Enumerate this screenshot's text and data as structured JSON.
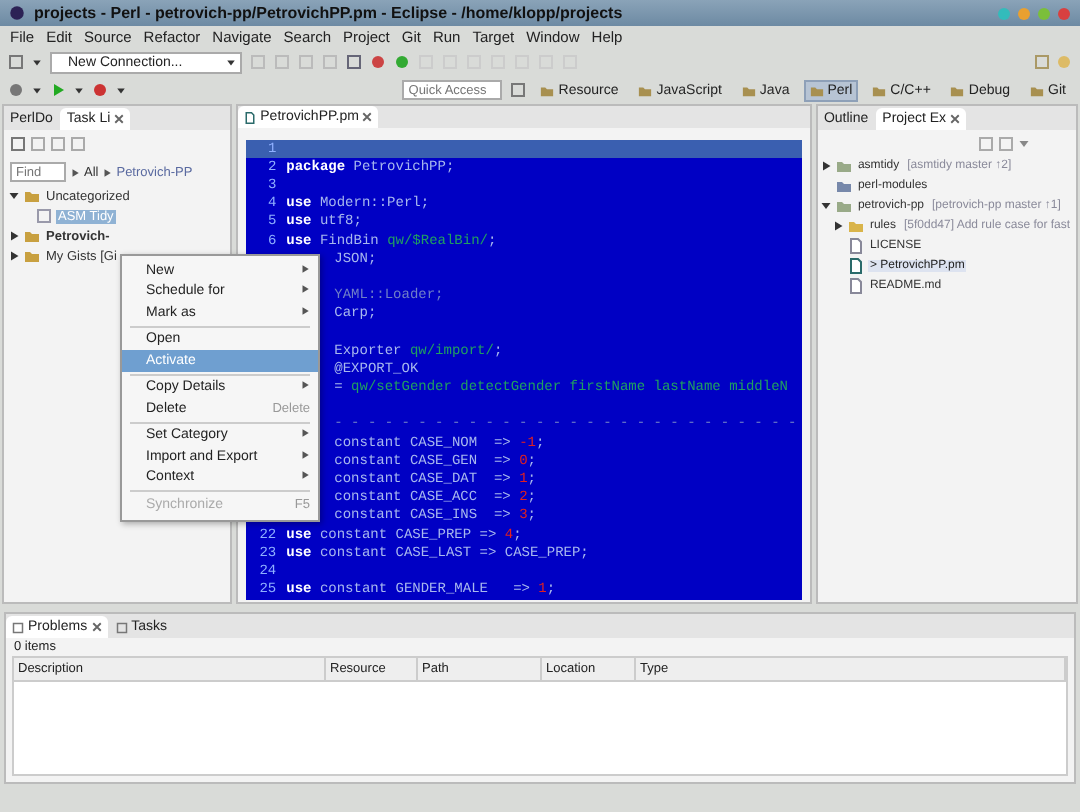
{
  "window": {
    "title": "projects - Perl - petrovich-pp/PetrovichPP.pm - Eclipse - /home/klopp/projects"
  },
  "menu": [
    "File",
    "Edit",
    "Source",
    "Refactor",
    "Navigate",
    "Search",
    "Project",
    "Git",
    "Run",
    "Target",
    "Window",
    "Help"
  ],
  "toolbar": {
    "connection": "New Connection...",
    "quick_access": {
      "placeholder": "Quick Access"
    },
    "perspectives": [
      {
        "label": "Resource",
        "selected": false
      },
      {
        "label": "JavaScript",
        "selected": false
      },
      {
        "label": "Java",
        "selected": false
      },
      {
        "label": "Perl",
        "selected": true
      },
      {
        "label": "C/C++",
        "selected": false
      },
      {
        "label": "Debug",
        "selected": false
      },
      {
        "label": "Git",
        "selected": false
      }
    ]
  },
  "left_panel": {
    "tabs": [
      {
        "label": "PerlDo",
        "selected": false
      },
      {
        "label": "Task Li",
        "selected": true
      }
    ],
    "find": {
      "placeholder": "Find"
    },
    "breadcrumb": [
      "All",
      "Petrovich-PP"
    ],
    "tree": [
      {
        "label": "Uncategorized",
        "expanded": true,
        "children": [
          {
            "label": "ASM Tidy",
            "selected": true
          }
        ]
      },
      {
        "label": "Petrovich-",
        "expanded": false
      },
      {
        "label": "My Gists [Gi",
        "expanded": false
      }
    ]
  },
  "context_menu": [
    {
      "label": "New",
      "kind": "submenu",
      "selected": false,
      "disabled": false
    },
    {
      "label": "Schedule for",
      "kind": "submenu",
      "selected": false,
      "disabled": false
    },
    {
      "label": "Mark as",
      "kind": "submenu",
      "selected": false,
      "disabled": false
    },
    {
      "kind": "separator"
    },
    {
      "label": "Open",
      "kind": "item",
      "selected": false,
      "disabled": false
    },
    {
      "label": "Activate",
      "kind": "item",
      "selected": true,
      "disabled": false
    },
    {
      "kind": "separator"
    },
    {
      "label": "Copy Details",
      "kind": "submenu",
      "selected": false,
      "disabled": false
    },
    {
      "label": "Delete",
      "kind": "item",
      "shortcut": "Delete",
      "selected": false,
      "disabled": false
    },
    {
      "kind": "separator"
    },
    {
      "label": "Set Category",
      "kind": "submenu",
      "selected": false,
      "disabled": false
    },
    {
      "label": "Import and Export",
      "kind": "submenu",
      "selected": false,
      "disabled": false
    },
    {
      "label": "Context",
      "kind": "submenu",
      "selected": false,
      "disabled": false
    },
    {
      "kind": "separator"
    },
    {
      "label": "Synchronize",
      "kind": "item",
      "shortcut": "F5",
      "selected": false,
      "disabled": true
    }
  ],
  "editor": {
    "tab": "PetrovichPP.pm",
    "lines": [
      {
        "number": "1",
        "current": true
      },
      {
        "number": "2",
        "current": false,
        "tokens": [
          {
            "text": "package",
            "kind": "kw"
          },
          {
            "text": " PetrovichPP;",
            "kind": "plain"
          }
        ]
      },
      {
        "number": "3",
        "current": false
      },
      {
        "number": "4",
        "current": false,
        "tokens": [
          {
            "text": "use",
            "kind": "kw"
          },
          {
            "text": " Modern::Perl;",
            "kind": "plain"
          }
        ]
      },
      {
        "number": "5",
        "current": false,
        "tokens": [
          {
            "text": "use",
            "kind": "kw"
          },
          {
            "text": " utf8;",
            "kind": "plain"
          }
        ]
      },
      {
        "number": "6",
        "current": false,
        "tokens": [
          {
            "text": "use",
            "kind": "kw"
          },
          {
            "text": " FindBin ",
            "kind": "plain"
          },
          {
            "text": "qw/$RealBin/",
            "kind": "str"
          },
          {
            "text": ";",
            "kind": "plain"
          }
        ]
      },
      {
        "current": false,
        "tokens": [
          {
            "text": "JSON;",
            "kind": "plain"
          }
        ]
      },
      {
        "current": false
      },
      {
        "current": false,
        "tokens": [
          {
            "text": "YAML::Loader;",
            "kind": "comment"
          }
        ]
      },
      {
        "current": false,
        "tokens": [
          {
            "text": "Carp;",
            "kind": "plain"
          }
        ]
      },
      {
        "current": false
      },
      {
        "current": false,
        "tokens": [
          {
            "text": "Exporter ",
            "kind": "plain"
          },
          {
            "text": "qw/import/",
            "kind": "str"
          },
          {
            "text": ";",
            "kind": "plain"
          }
        ]
      },
      {
        "current": false,
        "tokens": [
          {
            "text": "@EXPORT_OK",
            "kind": "plain"
          }
        ]
      },
      {
        "current": false,
        "tokens": [
          {
            "text": "= ",
            "kind": "plain"
          },
          {
            "text": "qw/setGender detectGender firstName lastName middleN",
            "kind": "str"
          }
        ]
      },
      {
        "current": false
      },
      {
        "current": false,
        "tokens": [
          {
            "text": "- - - - - - - - - - - - - - - - - - - - - - - - - - - -",
            "kind": "comment"
          }
        ]
      },
      {
        "current": false,
        "tokens": [
          {
            "text": "constant CASE_NOM  => ",
            "kind": "plain"
          },
          {
            "text": "-1",
            "kind": "num"
          },
          {
            "text": ";",
            "kind": "plain"
          }
        ]
      },
      {
        "current": false,
        "tokens": [
          {
            "text": "constant CASE_GEN  => ",
            "kind": "plain"
          },
          {
            "text": "0",
            "kind": "num"
          },
          {
            "text": ";",
            "kind": "plain"
          }
        ]
      },
      {
        "current": false,
        "tokens": [
          {
            "text": "constant CASE_DAT  => ",
            "kind": "plain"
          },
          {
            "text": "1",
            "kind": "num"
          },
          {
            "text": ";",
            "kind": "plain"
          }
        ]
      },
      {
        "current": false,
        "tokens": [
          {
            "text": "constant CASE_ACC  => ",
            "kind": "plain"
          },
          {
            "text": "2",
            "kind": "num"
          },
          {
            "text": ";",
            "kind": "plain"
          }
        ]
      },
      {
        "current": false,
        "tokens": [
          {
            "text": "constant CASE_INS  => ",
            "kind": "plain"
          },
          {
            "text": "3",
            "kind": "num"
          },
          {
            "text": ";",
            "kind": "plain"
          }
        ]
      },
      {
        "number": "22",
        "current": false,
        "tokens": [
          {
            "text": "use",
            "kind": "kw"
          },
          {
            "text": " constant CASE_PREP => ",
            "kind": "plain"
          },
          {
            "text": "4",
            "kind": "num"
          },
          {
            "text": ";",
            "kind": "plain"
          }
        ]
      },
      {
        "number": "23",
        "current": false,
        "tokens": [
          {
            "text": "use",
            "kind": "kw"
          },
          {
            "text": " constant CASE_LAST => CASE_PREP;",
            "kind": "plain"
          }
        ]
      },
      {
        "number": "24",
        "current": false
      },
      {
        "number": "25",
        "current": false,
        "tokens": [
          {
            "text": "use",
            "kind": "kw"
          },
          {
            "text": " constant GENDER_MALE   => ",
            "kind": "plain"
          },
          {
            "text": "1",
            "kind": "num"
          },
          {
            "text": ";",
            "kind": "plain"
          }
        ]
      }
    ]
  },
  "right_panel": {
    "tabs": [
      {
        "label": "Outline",
        "selected": false
      },
      {
        "label": "Project Ex",
        "selected": true
      }
    ],
    "tree": [
      {
        "label": "asmtidy",
        "decoration": "[asmtidy master ↑2]",
        "kind": "project",
        "expanded": false,
        "selected": false
      },
      {
        "label": "perl-modules",
        "kind": "module",
        "selected": false
      },
      {
        "label": "petrovich-pp",
        "decoration": "[petrovich-pp master ↑1]",
        "kind": "project",
        "expanded": true,
        "selected": false,
        "children": [
          {
            "label": "rules",
            "decoration": "[5f0dd47] Add rule case for fast",
            "kind": "folder",
            "expanded": false,
            "selected": false
          },
          {
            "label": "LICENSE",
            "kind": "file",
            "selected": false
          },
          {
            "label": "> PetrovichPP.pm",
            "kind": "perl",
            "selected": true
          },
          {
            "label": "README.md",
            "kind": "file",
            "selected": false
          }
        ]
      }
    ]
  },
  "bottom_panel": {
    "tabs": [
      {
        "label": "Problems",
        "selected": true
      },
      {
        "label": "Tasks",
        "selected": false
      }
    ],
    "summary": "0 items",
    "columns": [
      "Description",
      "Resource",
      "Path",
      "Location",
      "Type"
    ]
  }
}
